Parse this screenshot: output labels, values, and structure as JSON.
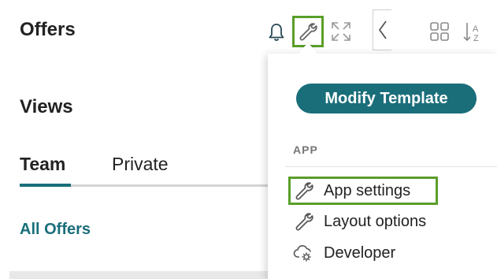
{
  "header": {
    "title": "Offers",
    "icons": {
      "notifications": "bell-icon",
      "settings": "wrench-icon",
      "expand": "expand-icon",
      "collapse": "chevron-left-icon",
      "grid": "grid-icon",
      "sort": "sort-icon"
    }
  },
  "views": {
    "title": "Views",
    "tabs": [
      {
        "label": "Team",
        "active": true
      },
      {
        "label": "Private",
        "active": false
      }
    ],
    "link": "All Offers"
  },
  "dropdown": {
    "primary_button": "Modify Template",
    "section_label": "APP",
    "items": [
      {
        "label": "App settings",
        "icon": "wrench-icon",
        "highlighted": true
      },
      {
        "label": "Layout options",
        "icon": "wrench-icon",
        "highlighted": false
      },
      {
        "label": "Developer",
        "icon": "cloud-gear-icon",
        "highlighted": false
      }
    ]
  },
  "colors": {
    "accent": "#1a6e7a",
    "highlight": "#5a9e2a",
    "text": "#222222",
    "muted": "#777777"
  }
}
